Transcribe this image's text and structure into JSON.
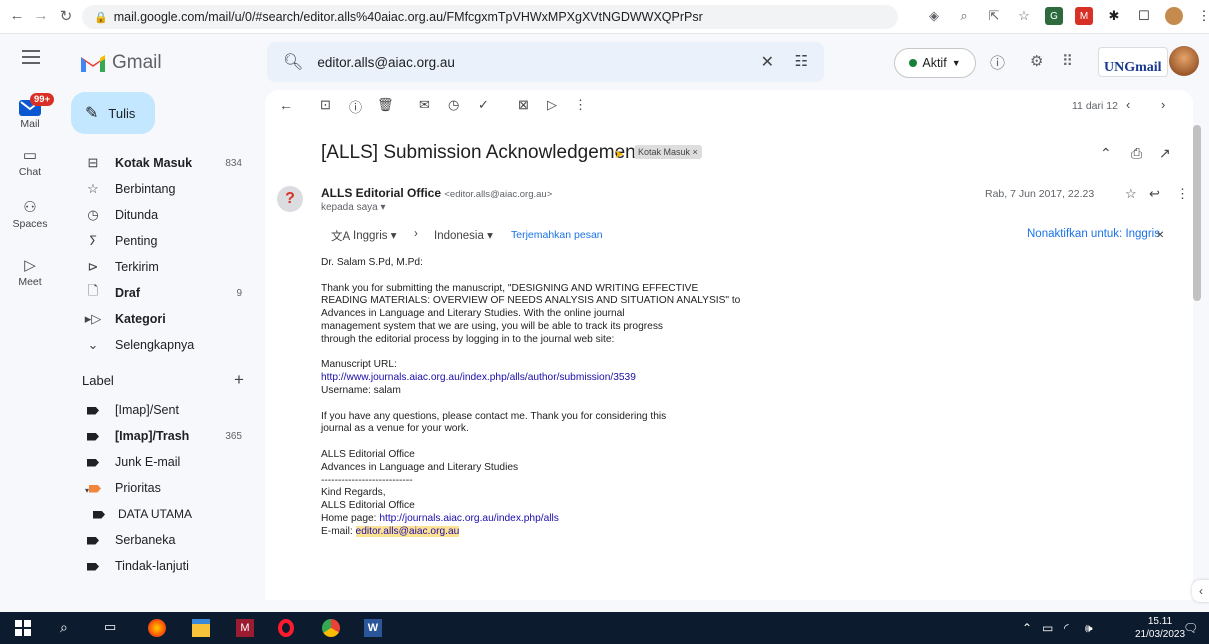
{
  "browser": {
    "url": "mail.google.com/mail/u/0/#search/editor.alls%40aiac.org.au/FMfcgxmTpVHWxMPXgXVtNGDWWXQPrPsr"
  },
  "app": {
    "name": "Gmail"
  },
  "search": {
    "value": "editor.alls@aiac.org.au"
  },
  "status": {
    "label": "Aktif"
  },
  "account": {
    "logo_text": "UNGmail"
  },
  "rail": {
    "mail_badge": "99+",
    "items": [
      {
        "label": "Mail",
        "icon": "mail-icon"
      },
      {
        "label": "Chat",
        "icon": "chat-icon"
      },
      {
        "label": "Spaces",
        "icon": "spaces-icon"
      },
      {
        "label": "Meet",
        "icon": "meet-icon"
      }
    ]
  },
  "compose": {
    "label": "Tulis"
  },
  "sidebar": {
    "items": [
      {
        "label": "Kotak Masuk",
        "count": "834",
        "icon": "inbox-icon",
        "bold": true
      },
      {
        "label": "Berbintang",
        "count": "",
        "icon": "star-icon",
        "bold": false
      },
      {
        "label": "Ditunda",
        "count": "",
        "icon": "clock-icon",
        "bold": false
      },
      {
        "label": "Penting",
        "count": "",
        "icon": "important-icon",
        "bold": false
      },
      {
        "label": "Terkirim",
        "count": "",
        "icon": "send-icon",
        "bold": false
      },
      {
        "label": "Draf",
        "count": "9",
        "icon": "draft-icon",
        "bold": true
      },
      {
        "label": "Kategori",
        "count": "",
        "icon": "category-icon",
        "bold": true
      },
      {
        "label": "Selengkapnya",
        "count": "",
        "icon": "chevron-down-icon",
        "bold": false
      }
    ],
    "labels_heading": "Label",
    "labels": [
      {
        "label": "[Imap]/Sent",
        "count": "",
        "bold": false
      },
      {
        "label": "[Imap]/Trash",
        "count": "365",
        "bold": true
      },
      {
        "label": "Junk E-mail",
        "count": "",
        "bold": false
      },
      {
        "label": "Prioritas",
        "count": "",
        "bold": false,
        "color": "#f4863b"
      },
      {
        "label": "DATA UTAMA",
        "count": "",
        "bold": false
      },
      {
        "label": "Serbaneka",
        "count": "",
        "bold": false
      },
      {
        "label": "Tindak-lanjuti",
        "count": "",
        "bold": false
      }
    ]
  },
  "toolbar": {
    "pager": "11 dari 12"
  },
  "message": {
    "subject": "[ALLS] Submission Acknowledgement",
    "chip": "Kotak Masuk ×",
    "sender_name": "ALLS Editorial Office",
    "sender_email": "<editor.alls@aiac.org.au>",
    "to": "kepada saya ▾",
    "date": "Rab, 7 Jun 2017, 22.23",
    "translate": {
      "from": "Inggris ▾",
      "arrow": "›",
      "to": "Indonesia ▾",
      "link": "Terjemahkan pesan",
      "disable": "Nonaktifkan untuk: Inggris"
    },
    "body": {
      "greeting": "Dr. Salam S.Pd, M.Pd:",
      "p1": [
        "Thank you for submitting the manuscript, \"DESIGNING AND WRITING EFFECTIVE",
        "READING MATERIALS: OVERVIEW OF NEEDS ANALYSIS AND SITUATION ANALYSIS\" to",
        "Advances in Language and Literary Studies. With the online journal",
        "management system that we are using, you will be able to track its progress",
        "through the editorial process by logging in to the journal web site:"
      ],
      "url_label": "Manuscript URL:",
      "url": "http://www.journals.aiac.org.au/index.php/alls/author/submission/3539",
      "username": "Username: salam",
      "p2": [
        "If you have any questions, please contact me. Thank you for considering this",
        "journal as a venue for your work."
      ],
      "sig1": "ALLS Editorial Office",
      "sig2": "Advances in Language and Literary Studies",
      "divider": "---------------------------",
      "regards": "Kind Regards,",
      "sig3": "ALLS Editorial Office",
      "home_label": "Home page: ",
      "home_url": "http://journals.aiac.org.au/index.php/alls",
      "email_label": "E-mail: ",
      "email": "editor.alls@aiac.org.au"
    }
  },
  "taskbar": {
    "time": "15.11",
    "date": "21/03/2023"
  }
}
